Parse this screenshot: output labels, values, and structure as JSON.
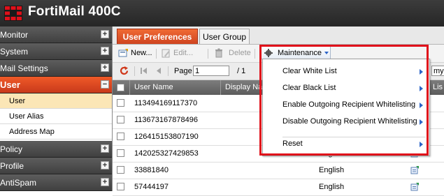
{
  "app": {
    "title": "FortiMail 400C"
  },
  "sidebar": {
    "sections": [
      {
        "label": "Monitor",
        "toggle": "+"
      },
      {
        "label": "System",
        "toggle": "+"
      },
      {
        "label": "Mail Settings",
        "toggle": "+"
      },
      {
        "label": "User",
        "toggle": "−"
      },
      {
        "label": "Policy",
        "toggle": "+"
      },
      {
        "label": "Profile",
        "toggle": "+"
      },
      {
        "label": "AntiSpam",
        "toggle": "+"
      }
    ],
    "user_items": [
      {
        "label": "User",
        "selected": true
      },
      {
        "label": "User Alias",
        "selected": false
      },
      {
        "label": "Address Map",
        "selected": false
      }
    ]
  },
  "tabs": [
    {
      "label": "User Preferences",
      "active": true
    },
    {
      "label": "User Group",
      "active": false
    }
  ],
  "toolbar": {
    "new_label": "New...",
    "edit_label": "Edit...",
    "delete_label": "Delete",
    "maintenance_label": "Maintenance"
  },
  "pager": {
    "page_label": "Page",
    "page_value": "1",
    "of_label": "/ 1",
    "search_value": "myc"
  },
  "table": {
    "columns": [
      "User Name",
      "Display Na",
      "Lis"
    ],
    "rows": [
      {
        "name": "113494169117370",
        "language": ""
      },
      {
        "name": "113673167878496",
        "language": ""
      },
      {
        "name": "126415153807190",
        "language": ""
      },
      {
        "name": "142025327429853",
        "language": "English"
      },
      {
        "name": "33881840",
        "language": "English"
      },
      {
        "name": "57444197",
        "language": "English"
      }
    ]
  },
  "maintenance_menu": {
    "items": [
      {
        "label": "Clear White List"
      },
      {
        "label": "Clear Black List"
      },
      {
        "label": "Enable Outgoing Recipient Whitelisting"
      },
      {
        "label": "Disable Outgoing Recipient Whitelisting"
      },
      {
        "label": "Reset"
      }
    ]
  },
  "colors": {
    "brand": "#e04d1f",
    "highlight": "#e0101a",
    "header_bg": "#2f2f2f",
    "selected_row": "#fbe6b6",
    "submenu_arrow": "#2b64c8"
  },
  "icons": {
    "logo": "fortinet-logo",
    "maintenance": "gear-icon",
    "new": "new-icon",
    "edit": "edit-icon",
    "delete": "trash-icon",
    "refresh": "refresh-icon",
    "first_page": "first-page-icon",
    "prev_page": "prev-page-icon"
  }
}
